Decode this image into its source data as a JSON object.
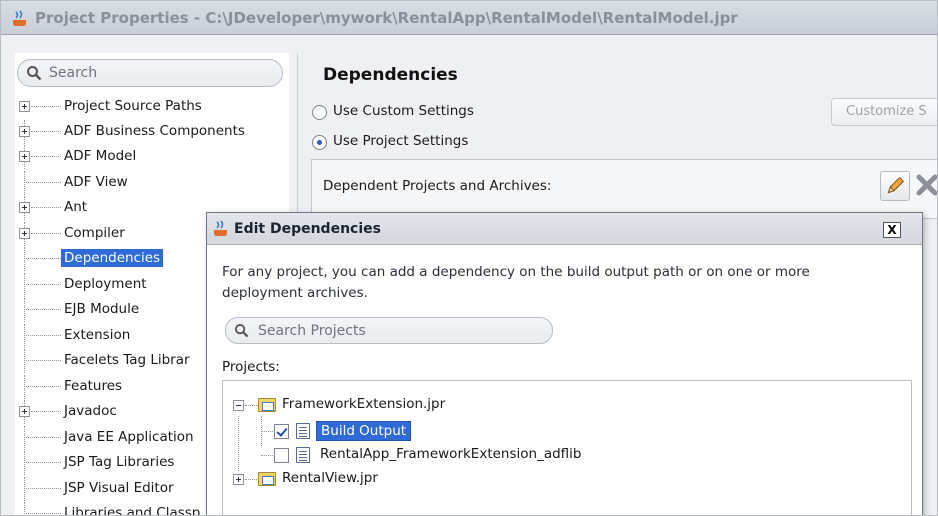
{
  "window": {
    "title": "Project Properties - C:\\JDeveloper\\mywork\\RentalApp\\RentalModel\\RentalModel.jpr"
  },
  "sidebar": {
    "search_placeholder": "Search",
    "items": [
      {
        "label": "Project Source Paths",
        "expandable": true
      },
      {
        "label": "ADF Business Components",
        "expandable": true
      },
      {
        "label": "ADF Model",
        "expandable": true
      },
      {
        "label": "ADF View",
        "expandable": false
      },
      {
        "label": "Ant",
        "expandable": true
      },
      {
        "label": "Compiler",
        "expandable": true
      },
      {
        "label": "Dependencies",
        "expandable": false,
        "selected": true
      },
      {
        "label": "Deployment",
        "expandable": false
      },
      {
        "label": "EJB Module",
        "expandable": false
      },
      {
        "label": "Extension",
        "expandable": false
      },
      {
        "label": "Facelets Tag Librar",
        "expandable": false
      },
      {
        "label": "Features",
        "expandable": false
      },
      {
        "label": "Javadoc",
        "expandable": true
      },
      {
        "label": "Java EE Application",
        "expandable": false
      },
      {
        "label": "JSP Tag Libraries",
        "expandable": false
      },
      {
        "label": "JSP Visual Editor",
        "expandable": false
      },
      {
        "label": "Libraries and Classp",
        "expandable": false
      }
    ]
  },
  "main": {
    "title": "Dependencies",
    "custom_settings_label": "Use Custom Settings",
    "project_settings_label": "Use Project Settings",
    "selected_setting": "project",
    "customize_button": "Customize S",
    "dependent_projects_label": "Dependent Projects and Archives:"
  },
  "dialog": {
    "title": "Edit Dependencies",
    "close_glyph": "X",
    "description": "For any project, you can add a dependency on the build output path or on one or more deployment archives.",
    "search_placeholder": "Search Projects",
    "projects_label": "Projects:",
    "tree": {
      "framework_project": "FrameworkExtension.jpr",
      "build_output": "Build Output",
      "build_output_checked": true,
      "adflib": "RentalApp_FrameworkExtension_adflib",
      "adflib_checked": false,
      "rental_view": "RentalView.jpr"
    }
  },
  "colors": {
    "selection": "#2e6bd6",
    "window_bg": "#eef0f3"
  }
}
